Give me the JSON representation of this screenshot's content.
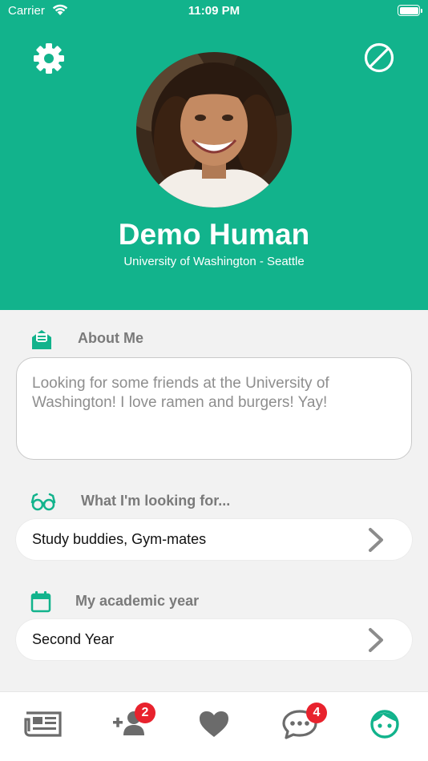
{
  "status": {
    "carrier": "Carrier",
    "time": "11:09 PM"
  },
  "profile": {
    "name": "Demo Human",
    "school": "University of Washington - Seattle"
  },
  "about": {
    "label": "About Me",
    "text": "Looking for some friends at the University of Washington! I love ramen and burgers! Yay!"
  },
  "looking_for": {
    "label": "What I'm looking for...",
    "value": "Study buddies, Gym-mates"
  },
  "academic_year": {
    "label": "My academic year",
    "value": "Second Year"
  },
  "tabs": {
    "friend_requests_badge": "2",
    "messages_badge": "4"
  },
  "colors": {
    "accent": "#12b38c",
    "tab_icon": "#6b6b6b",
    "badge": "#e8222d",
    "section_label": "#7a7a7a"
  },
  "icons": {
    "header_left": "gear-icon",
    "header_right": "block-icon",
    "about": "envelope-open-icon",
    "looking_for": "glasses-icon",
    "academic_year": "calendar-icon",
    "tab1": "newspaper-icon",
    "tab2": "add-friend-icon",
    "tab3": "heart-icon",
    "tab4": "chat-bubble-icon",
    "tab5": "face-icon"
  }
}
